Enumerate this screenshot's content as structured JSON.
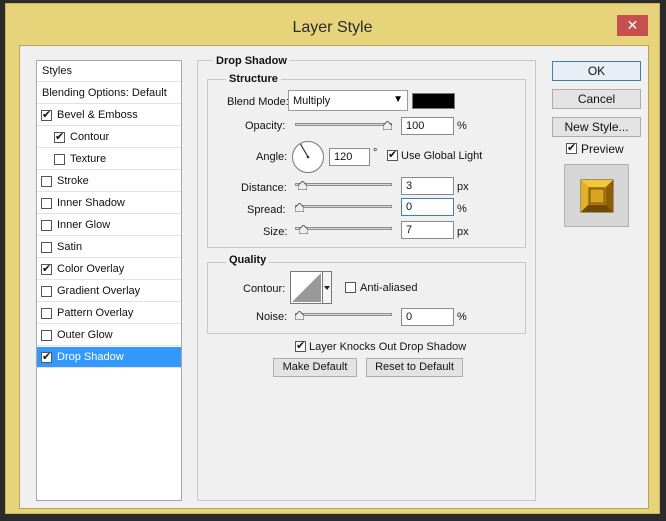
{
  "window": {
    "title": "Layer Style",
    "close_glyph": "✕"
  },
  "sidebar": {
    "items": [
      {
        "label": "Styles",
        "checkbox": false,
        "checked": false
      },
      {
        "label": "Blending Options: Default",
        "checkbox": false,
        "checked": false
      },
      {
        "label": "Bevel & Emboss",
        "checkbox": true,
        "checked": true
      },
      {
        "label": "Contour",
        "checkbox": true,
        "checked": true,
        "indent": true
      },
      {
        "label": "Texture",
        "checkbox": true,
        "checked": false,
        "indent": true
      },
      {
        "label": "Stroke",
        "checkbox": true,
        "checked": false
      },
      {
        "label": "Inner Shadow",
        "checkbox": true,
        "checked": false
      },
      {
        "label": "Inner Glow",
        "checkbox": true,
        "checked": false
      },
      {
        "label": "Satin",
        "checkbox": true,
        "checked": false
      },
      {
        "label": "Color Overlay",
        "checkbox": true,
        "checked": true
      },
      {
        "label": "Gradient Overlay",
        "checkbox": true,
        "checked": false
      },
      {
        "label": "Pattern Overlay",
        "checkbox": true,
        "checked": false
      },
      {
        "label": "Outer Glow",
        "checkbox": true,
        "checked": false
      },
      {
        "label": "Drop Shadow",
        "checkbox": true,
        "checked": true,
        "selected": true
      }
    ]
  },
  "drop_shadow": {
    "section_title": "Drop Shadow",
    "structure_title": "Structure",
    "blend_mode_label": "Blend Mode:",
    "blend_mode_value": "Multiply",
    "shadow_color": "#000000",
    "opacity_label": "Opacity:",
    "opacity_value": "100",
    "opacity_fraction": 1.0,
    "angle_label": "Angle:",
    "angle_value": "120",
    "degree_symbol": "°",
    "use_global_light_label": "Use Global Light",
    "use_global_light_checked": true,
    "distance_label": "Distance:",
    "distance_value": "3",
    "distance_fraction": 0.03,
    "spread_label": "Spread:",
    "spread_value": "0",
    "spread_fraction": 0.0,
    "size_label": "Size:",
    "size_value": "7",
    "size_fraction": 0.05,
    "percent_unit": "%",
    "px_unit": "px"
  },
  "quality": {
    "title": "Quality",
    "contour_label": "Contour:",
    "anti_aliased_label": "Anti-aliased",
    "anti_aliased_checked": false,
    "noise_label": "Noise:",
    "noise_value": "0",
    "noise_fraction": 0.0,
    "noise_unit": "%"
  },
  "knocks_out": {
    "label": "Layer Knocks Out Drop Shadow",
    "checked": true
  },
  "buttons": {
    "make_default": "Make Default",
    "reset_to_default": "Reset to Default",
    "ok": "OK",
    "cancel": "Cancel",
    "new_style": "New Style..."
  },
  "preview": {
    "label": "Preview",
    "checked": true,
    "accent": "#d9a520"
  }
}
